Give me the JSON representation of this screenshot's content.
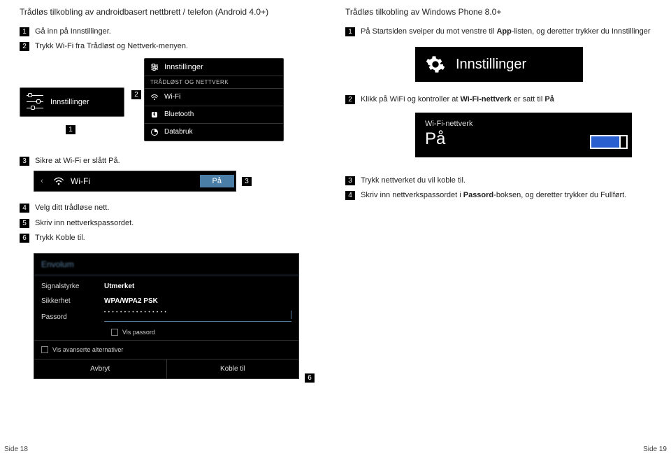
{
  "left": {
    "title": "Trådløs tilkobling av androidbasert nettbrett / telefon (Android 4.0+)",
    "steps": {
      "s1": "Gå inn på Innstillinger.",
      "s2": "Trykk Wi-Fi fra Trådløst og Nettverk-menyen.",
      "s3": "Sikre at Wi-Fi er slått På.",
      "s4": "Velg ditt trådløse nett.",
      "s5": "Skriv  inn nettverkspassordet.",
      "s6": "Trykk Koble til."
    },
    "android_left_label": "Innstillinger",
    "android_right": {
      "header": "Innstillinger",
      "section": "TRÅDLØST OG NETTVERK",
      "row_wifi": "Wi-Fi",
      "row_bt": "Bluetooth",
      "row_data": "Databruk"
    },
    "wifi_toggle": {
      "label": "Wi-Fi",
      "state": "På"
    },
    "dialog": {
      "title": "Envolum",
      "signal_label": "Signalstyrke",
      "signal_value": "Utmerket",
      "security_label": "Sikkerhet",
      "security_value": "WPA/WPA2 PSK",
      "password_label": "Passord",
      "show_pw": "Vis passord",
      "advanced": "Vis avanserte alternativer",
      "cancel": "Avbryt",
      "connect": "Koble til"
    }
  },
  "right": {
    "title": "Trådløs tilkobling av Windows Phone 8.0+",
    "steps": {
      "s1_a": "På Startsiden sveiper du mot venstre til ",
      "s1_b": "App",
      "s1_c": "-listen, og deretter trykker du Innstillinger",
      "s2_a": "Klikk på WiFi og kontroller at ",
      "s2_b": "Wi-Fi-nettverk",
      "s2_c": " er satt til ",
      "s2_d": "På",
      "s3": "Trykk nettverket du vil koble til.",
      "s4_a": "Skriv inn nettverkspassordet i ",
      "s4_b": "Passord",
      "s4_c": "-boksen, og deretter trykker du Fullført."
    },
    "tile_label": "Innstillinger",
    "panel": {
      "small": "Wi-Fi-nettverk",
      "big": "På"
    }
  },
  "footer": {
    "left": "Side 18",
    "right": "Side 19"
  },
  "numbers": {
    "n1": "1",
    "n2": "2",
    "n3": "3",
    "n4": "4",
    "n5": "5",
    "n6": "6"
  }
}
